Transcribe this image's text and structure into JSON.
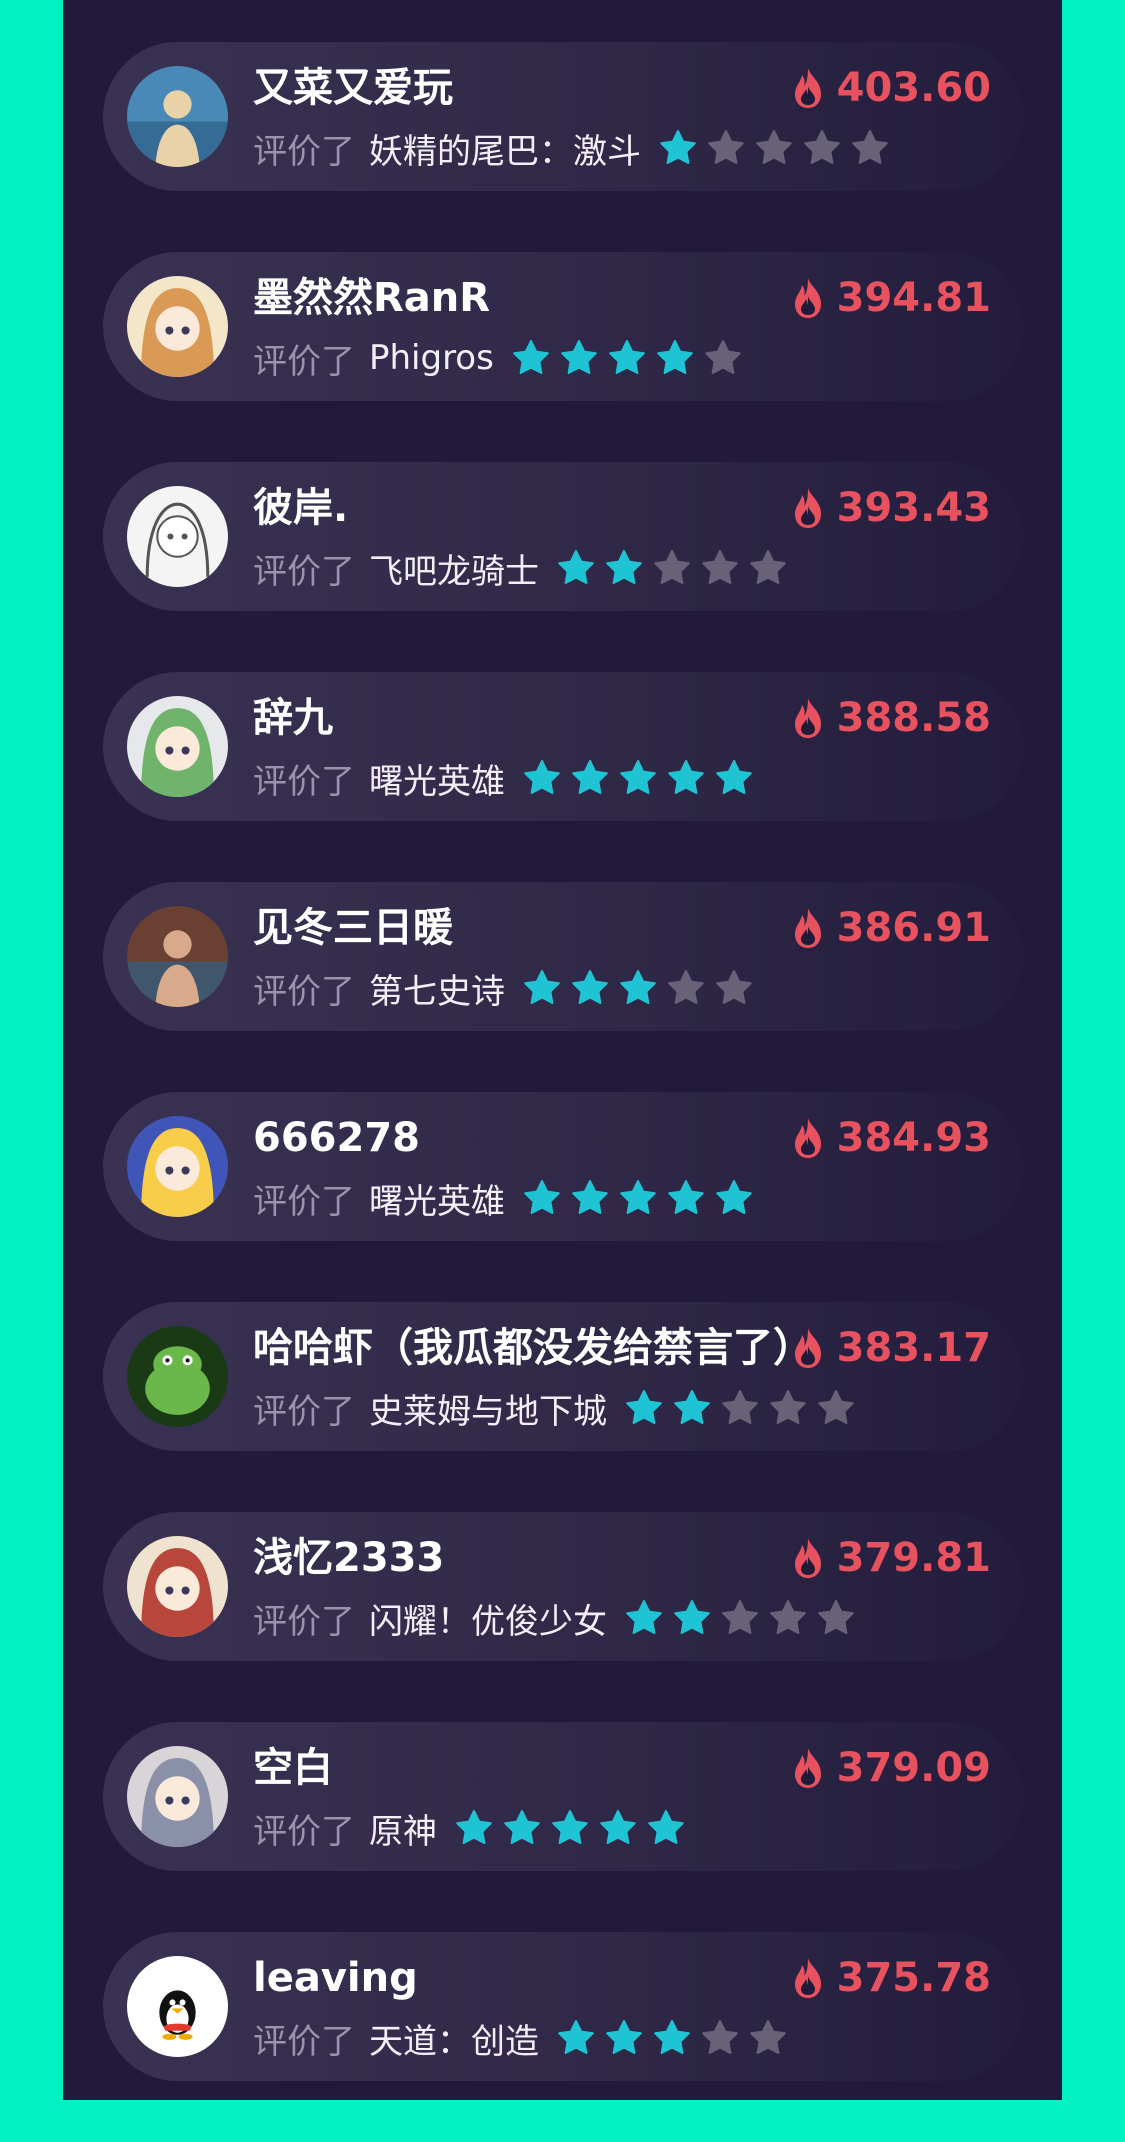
{
  "colors": {
    "background": "#00f2c3",
    "panel": "#211a3a",
    "card": "#332c4c",
    "score": "#e8525e",
    "star_filled": "#1ec4d4",
    "star_empty": "#686279",
    "verb_text": "#9a93ad"
  },
  "icons": {
    "score": "flame-icon",
    "rating": "star-icon"
  },
  "review_verb": "评价了",
  "entries": [
    {
      "name": "又菜又爱玩",
      "score": "403.60",
      "game": "妖精的尾巴：激斗",
      "rating": 1,
      "avatar": {
        "kind": "photo",
        "bg": "#4a88b8",
        "fg": "#e9d1a8"
      }
    },
    {
      "name": "墨然然RanR",
      "score": "394.81",
      "game": "Phigros",
      "rating": 4,
      "avatar": {
        "kind": "anime",
        "bg": "#f4e6c8",
        "fg": "#d99a55"
      }
    },
    {
      "name": "彼岸.",
      "score": "393.43",
      "game": "飞吧龙骑士",
      "rating": 2,
      "avatar": {
        "kind": "sketch",
        "bg": "#f4f4f4",
        "fg": "#555555"
      }
    },
    {
      "name": "辞九",
      "score": "388.58",
      "game": "曙光英雄",
      "rating": 5,
      "avatar": {
        "kind": "anime",
        "bg": "#e6e8ec",
        "fg": "#6fb46a"
      }
    },
    {
      "name": "见冬三日暖",
      "score": "386.91",
      "game": "第七史诗",
      "rating": 3,
      "avatar": {
        "kind": "photo",
        "bg": "#6a4032",
        "fg": "#d8a98a"
      }
    },
    {
      "name": "666278",
      "score": "384.93",
      "game": "曙光英雄",
      "rating": 5,
      "avatar": {
        "kind": "anime",
        "bg": "#3f56b8",
        "fg": "#f7cd4a"
      }
    },
    {
      "name": "哈哈虾（我瓜都没发给禁言了）",
      "score": "383.17",
      "game": "史莱姆与地下城",
      "rating": 2,
      "avatar": {
        "kind": "cartoon",
        "bg": "#1a3a16",
        "fg": "#6bb84a"
      }
    },
    {
      "name": "浅忆2333",
      "score": "379.81",
      "game": "闪耀！优俊少女",
      "rating": 2,
      "avatar": {
        "kind": "anime",
        "bg": "#efe3cf",
        "fg": "#b8463a"
      }
    },
    {
      "name": "空白",
      "score": "379.09",
      "game": "原神",
      "rating": 5,
      "avatar": {
        "kind": "anime",
        "bg": "#d8d4d8",
        "fg": "#8a90a8"
      }
    },
    {
      "name": "leaving",
      "score": "375.78",
      "game": "天道：创造",
      "rating": 3,
      "avatar": {
        "kind": "penguin",
        "bg": "#ffffff",
        "fg": "#111111"
      }
    }
  ]
}
